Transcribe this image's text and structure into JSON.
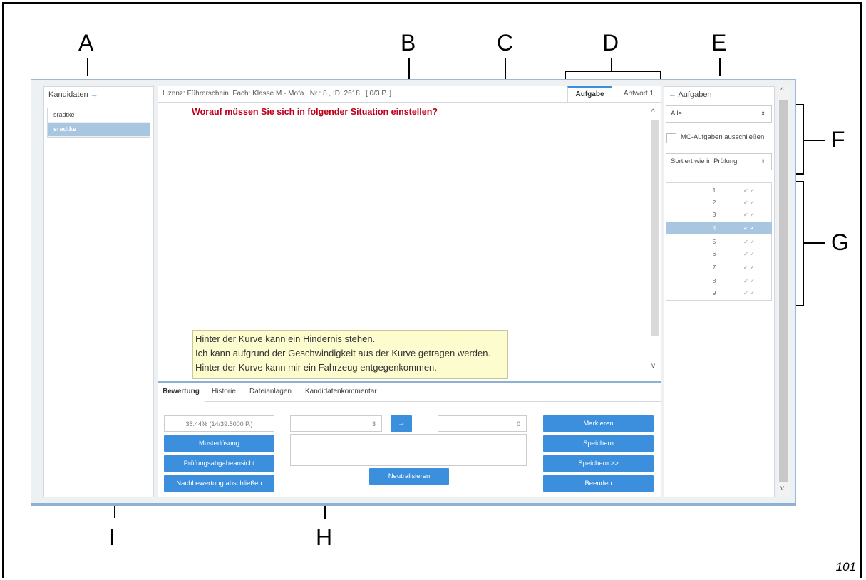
{
  "page_number": "101",
  "annotations": {
    "A": "A",
    "B": "B",
    "C": "C",
    "D": "D",
    "E": "E",
    "F": "F",
    "G": "G",
    "H": "H",
    "I": "I"
  },
  "left_panel": {
    "header": "Kandidaten",
    "arrow": "→",
    "candidates": [
      "sradtke",
      "sradtke"
    ]
  },
  "center": {
    "info": "Lizenz: Führerschein, Fach: Klasse M - Mofa   Nr.: 8 , ID: 2618   [ 0/3 P. ]",
    "tabs": [
      "Aufgabe",
      "Antwort 1"
    ],
    "question": "Worauf müssen Sie sich in folgender Situation einstellen?",
    "answer_lines": [
      "Hinter der Kurve kann ein Hindernis stehen.",
      "Ich kann aufgrund der Geschwindigkeit aus der Kurve getragen werden.",
      "Hinter der Kurve kann mir ein Fahrzeug entgegenkommen."
    ],
    "bottom_tabs": [
      "Bewertung",
      "Historie",
      "Dateianlagen",
      "Kandidatenkommentar"
    ],
    "score": "35.44% (14/39.5000 P.)",
    "left_buttons": [
      "Musterlösung",
      "Prüfungsabgabeansicht",
      "Nachbewertung abschließen"
    ],
    "points_in": "3",
    "points_out": "0",
    "transfer_arrow": "→",
    "neutralize": "Neutralisieren",
    "right_buttons": [
      "Markieren",
      "Speichern",
      "Speichern >>",
      "Beenden"
    ]
  },
  "right_panel": {
    "arrow": "←",
    "header": "Aufgaben",
    "filter": "Alle",
    "mc_exclude_label": "MC-Aufgaben ausschließen",
    "sort": "Sortiert wie in Prüfung",
    "tasks": [
      "1",
      "2",
      "3",
      "4",
      "5",
      "6",
      "7",
      "8",
      "9"
    ],
    "selected_task": "4",
    "check_glyph": "✔ ✔"
  }
}
